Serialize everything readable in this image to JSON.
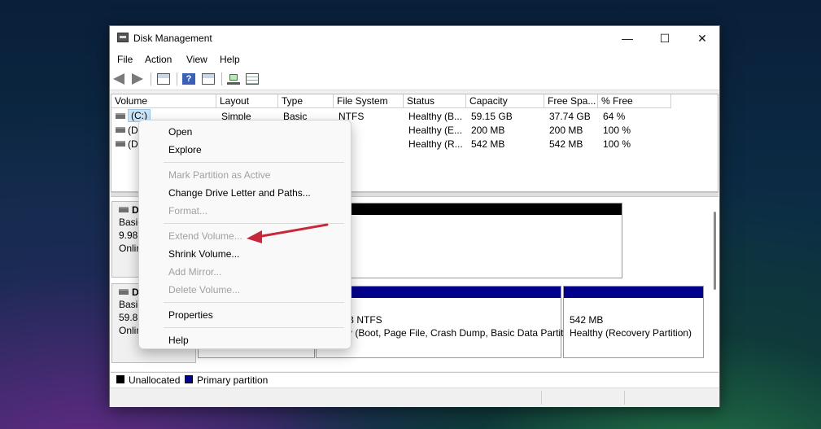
{
  "window": {
    "title": "Disk Management",
    "controls": {
      "minimize": "—",
      "maximize": "☐",
      "close": "✕"
    }
  },
  "menu": [
    "File",
    "Action",
    "View",
    "Help"
  ],
  "toolbar": {
    "icons": [
      "back-arrow-icon",
      "forward-arrow-icon",
      "console-tree-icon",
      "help-icon",
      "action-pane-icon",
      "connect-icon",
      "properties-icon"
    ],
    "help_glyph": "?"
  },
  "volume_table": {
    "columns": [
      "Volume",
      "Layout",
      "Type",
      "File System",
      "Status",
      "Capacity",
      "Free Spa...",
      "% Free"
    ],
    "rows": [
      {
        "volume": "(C:)",
        "layout": "Simple",
        "type": "Basic",
        "fs": "NTFS",
        "status": "Healthy (B...",
        "capacity": "59.15 GB",
        "free": "37.74 GB",
        "pct": "64 %"
      },
      {
        "volume": "(D",
        "layout": "",
        "type": "",
        "fs": "",
        "status": "Healthy (E...",
        "capacity": "200 MB",
        "free": "200 MB",
        "pct": "100 %"
      },
      {
        "volume": "(D",
        "layout": "",
        "type": "",
        "fs": "",
        "status": "Healthy (R...",
        "capacity": "542 MB",
        "free": "542 MB",
        "pct": "100 %"
      }
    ]
  },
  "disks": [
    {
      "name": "D",
      "lines": [
        "Basic",
        "9.98",
        "Onlin"
      ]
    },
    {
      "name": "D",
      "lines": [
        "Basic",
        "59.88",
        "Onlin"
      ]
    }
  ],
  "partitions": {
    "disk1_main": {
      "lines": [
        "B NTFS",
        "y (Boot, Page File, Crash Dump, Basic Data Partit"
      ]
    },
    "disk1_recovery": {
      "lines": [
        "542 MB",
        "Healthy (Recovery Partition)"
      ]
    }
  },
  "legend": [
    {
      "label": "Unallocated",
      "color": "#000000"
    },
    {
      "label": "Primary partition",
      "color": "#00008b"
    }
  ],
  "context_menu": {
    "groups": [
      [
        {
          "label": "Open",
          "enabled": true
        },
        {
          "label": "Explore",
          "enabled": true
        }
      ],
      [
        {
          "label": "Mark Partition as Active",
          "enabled": false
        },
        {
          "label": "Change Drive Letter and Paths...",
          "enabled": true
        },
        {
          "label": "Format...",
          "enabled": false
        }
      ],
      [
        {
          "label": "Extend Volume...",
          "enabled": false
        },
        {
          "label": "Shrink Volume...",
          "enabled": true
        },
        {
          "label": "Add Mirror...",
          "enabled": false
        },
        {
          "label": "Delete Volume...",
          "enabled": false
        }
      ],
      [
        {
          "label": "Properties",
          "enabled": true
        }
      ],
      [
        {
          "label": "Help",
          "enabled": true
        }
      ]
    ]
  },
  "colors": {
    "primary_partition": "#00008b",
    "unallocated": "#000000",
    "annotation_arrow": "#c8283c",
    "selection": "#cce4f7"
  }
}
